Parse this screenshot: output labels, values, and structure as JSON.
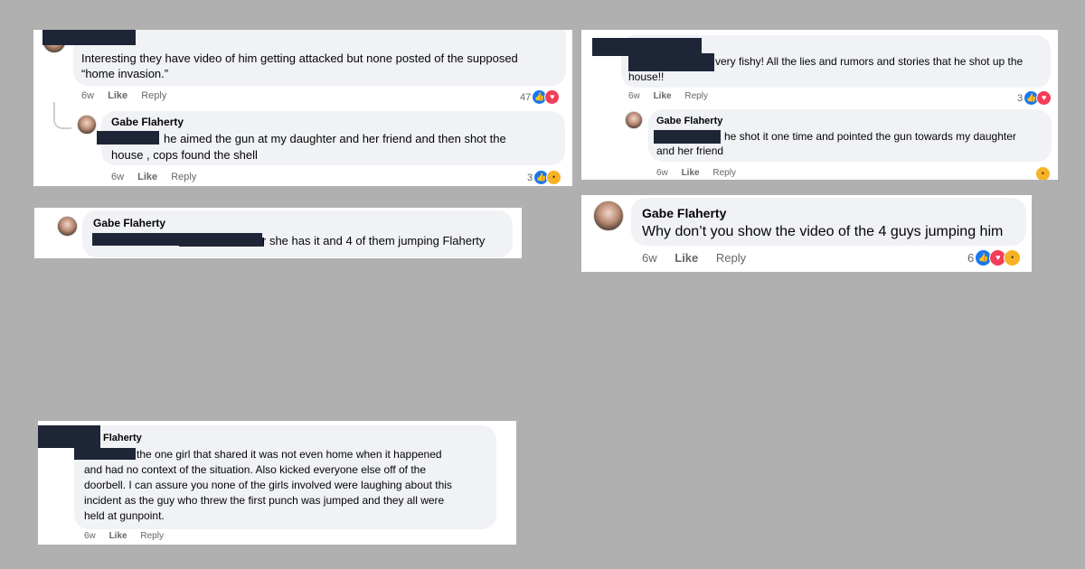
{
  "posts": [
    {
      "text": "Interesting they have video of him getting attacked but none posted of the supposed",
      "text2": "“home invasion.”",
      "age": "6w",
      "like": "Like",
      "reply": "Reply",
      "count": "47",
      "reply_comment": {
        "name": "Gabe Flaherty",
        "text": "he aimed the gun at my daughter and her friend and then shot the",
        "text2": "house , cops found the shell",
        "age": "6w",
        "like": "Like",
        "reply": "Reply",
        "count": "3"
      }
    },
    {
      "text": "very fishy! All the lies and rumors and stories that he shot up the",
      "text2": "house!!",
      "age": "6w",
      "like": "Like",
      "reply": "Reply",
      "count": "3",
      "reply_comment": {
        "name": "Gabe Flaherty",
        "text": "he shot it one time and pointed the gun towards my daughter",
        "text2": "and her friend",
        "age": "6w",
        "like": "Like",
        "reply": "Reply"
      }
    },
    {
      "name": "Gabe Flaherty",
      "text": "r she has it and 4 of them jumping Flaherty"
    },
    {
      "name": "Gabe Flaherty",
      "text": "Why don’t you show the video of the 4 guys jumping him",
      "age": "6w",
      "like": "Like",
      "reply": "Reply",
      "count": "6"
    },
    {
      "name": "Flaherty",
      "lines": [
        "the one girl that shared it was not even home when it happened",
        "and had no context of the situation. Also kicked everyone else off of the",
        "doorbell. I can assure you none of the girls involved were laughing about this",
        "incident as the guy who threw the first punch was jumped and they all were",
        "held at gunpoint."
      ],
      "age": "6w",
      "like": "Like",
      "reply": "Reply"
    }
  ],
  "icons": {
    "like": "thumbs-up-icon",
    "love": "heart-icon",
    "wow": "wow-face-icon",
    "haha": "haha-face-icon"
  },
  "colors": {
    "background": "#b0b0b0",
    "bubble": "#f0f2f5",
    "redaction": "#1d2536",
    "like_blue": "#1877f2",
    "love_red": "#f33e58",
    "emoji_yellow": "#f7b125"
  }
}
